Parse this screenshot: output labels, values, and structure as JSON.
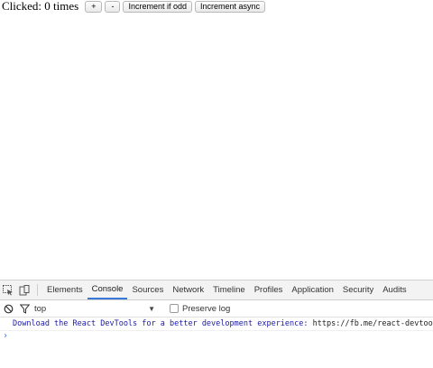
{
  "app": {
    "counter_text": "Clicked: 0 times",
    "buttons": {
      "increment": "+",
      "decrement": "-",
      "increment_if_odd": "Increment if odd",
      "increment_async": "Increment async"
    }
  },
  "devtools": {
    "tabs": [
      "Elements",
      "Console",
      "Sources",
      "Network",
      "Timeline",
      "Profiles",
      "Application",
      "Security",
      "Audits"
    ],
    "active_tab": "Console",
    "context_value": "top",
    "preserve_log_label": "Preserve log",
    "preserve_log_checked": false,
    "console": {
      "message_text": "Download the React DevTools for a better development experience: ",
      "message_url": "https://fb.me/react-devtools",
      "prompt_symbol": "›"
    }
  },
  "colors": {
    "accent": "#3879d9",
    "console_message": "#1a1aa6",
    "toolbar_bg": "#f3f3f3"
  },
  "icons": [
    "inspect-element-icon",
    "device-mode-icon",
    "clear-console-icon",
    "filter-icon",
    "dropdown-caret-icon"
  ]
}
